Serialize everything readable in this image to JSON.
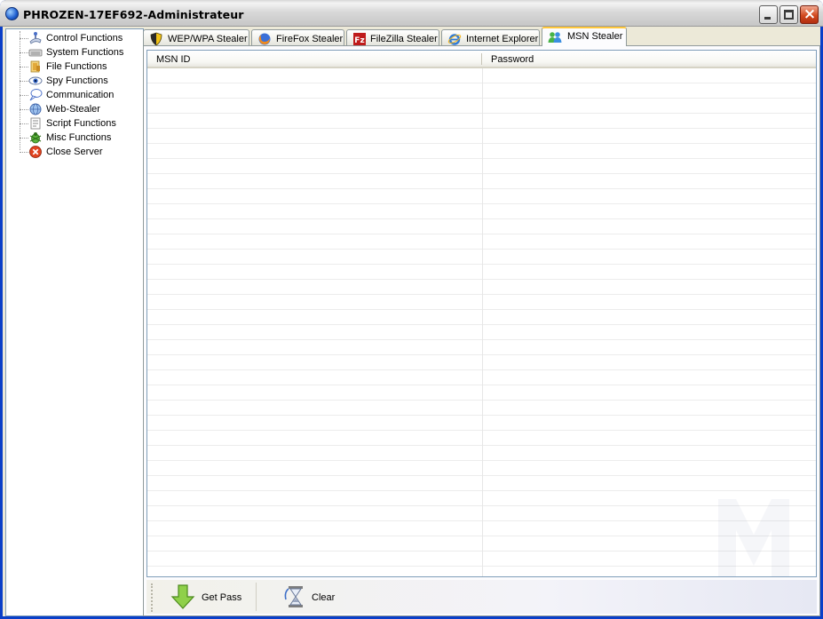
{
  "window": {
    "title": "PHROZEN-17EF692-Administrateur",
    "minimize_label": "_",
    "close_label": "×"
  },
  "sidebar": {
    "items": [
      {
        "label": "Control Functions",
        "icon": "joystick-icon"
      },
      {
        "label": "System Functions",
        "icon": "keyboard-icon"
      },
      {
        "label": "File Functions",
        "icon": "folder-icon"
      },
      {
        "label": "Spy Functions",
        "icon": "eye-icon"
      },
      {
        "label": "Communication",
        "icon": "chat-icon"
      },
      {
        "label": "Web-Stealer",
        "icon": "globe-icon"
      },
      {
        "label": "Script Functions",
        "icon": "script-icon"
      },
      {
        "label": "Misc Functions",
        "icon": "bug-icon"
      },
      {
        "label": "Close Server",
        "icon": "close-server-icon"
      }
    ]
  },
  "tabs": [
    {
      "label": "WEP/WPA Stealer",
      "icon": "shield-icon"
    },
    {
      "label": "FireFox Stealer",
      "icon": "firefox-icon"
    },
    {
      "label": "FileZilla Stealer",
      "icon": "filezilla-icon"
    },
    {
      "label": "Internet Explorer",
      "icon": "ie-icon"
    },
    {
      "label": "MSN Stealer",
      "icon": "msn-icon",
      "active": true
    }
  ],
  "table": {
    "columns": [
      "MSN ID",
      "Password"
    ],
    "rows": []
  },
  "toolbar": {
    "get_pass_label": "Get Pass",
    "clear_label": "Clear"
  },
  "colors": {
    "accent_tab": "#ffc83c",
    "border": "#7f9db9",
    "close_button": "#d24a1f"
  }
}
